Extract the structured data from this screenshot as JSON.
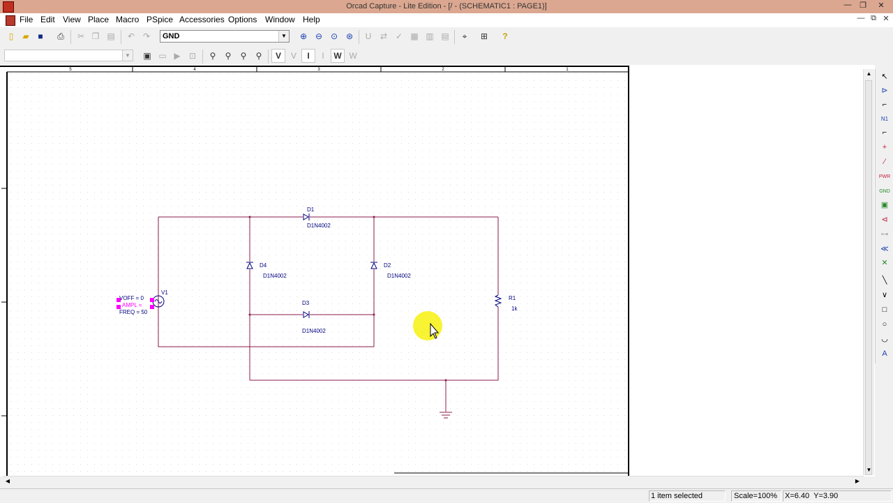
{
  "window": {
    "title": "Orcad Capture - Lite Edition - [/ - (SCHEMATIC1 : PAGE1)]",
    "controls": {
      "minimize": "—",
      "restore": "❐",
      "close": "✕"
    }
  },
  "menu": {
    "items": [
      "File",
      "Edit",
      "View",
      "Place",
      "Macro",
      "PSpice",
      "Accessories",
      "Options",
      "Window",
      "Help"
    ],
    "mdi_controls": {
      "minimize": "—",
      "restore": "⧉",
      "close": "✕"
    }
  },
  "toolbar": {
    "part_combo_value": "GND",
    "text_buttons": {
      "v": "V",
      "i": "I",
      "w": "W"
    }
  },
  "schematic": {
    "border_zones": [
      "5",
      "4",
      "3",
      "2",
      "1"
    ],
    "components": {
      "d1": {
        "ref": "D1",
        "value": "D1N4002"
      },
      "d2": {
        "ref": "D2",
        "value": "D1N4002"
      },
      "d3": {
        "ref": "D3",
        "value": "D1N4002"
      },
      "d4": {
        "ref": "D4",
        "value": "D1N4002"
      },
      "r1": {
        "ref": "R1",
        "value": "1k"
      },
      "v1": {
        "ref": "V1",
        "voff": "VOFF = 0",
        "ampl": "AMPL =",
        "freq": "FREQ = 50"
      }
    },
    "colors": {
      "wire": "#8b1a4a",
      "selection": "#ff00ff",
      "part": "#00007f",
      "cursor_highlight": "#f6f000"
    }
  },
  "status": {
    "selection": "1 item selected",
    "scale": "Scale=100%",
    "coordinates": "X=6.40  Y=3.90"
  }
}
